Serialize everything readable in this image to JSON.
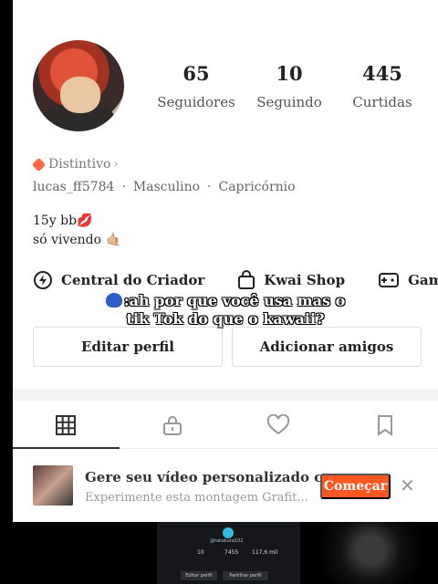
{
  "profile": {
    "stats": [
      {
        "value": "65",
        "label": "Seguidores"
      },
      {
        "value": "10",
        "label": "Seguindo"
      },
      {
        "value": "445",
        "label": "Curtidas"
      }
    ],
    "badge_label": "Distintivo",
    "username": "lucas_ff5784",
    "gender": "Masculino",
    "sign": "Capricórnio",
    "bio_line1": "15y bb💋",
    "bio_line2": "só vivendo 🤙🏼"
  },
  "links": {
    "creator": "Central do Criador",
    "shop": "Kwai Shop",
    "game": "Game"
  },
  "caption": {
    "line1": ":ah por que você usa mas o",
    "line2": "tik Tok do que o kawaii?"
  },
  "buttons": {
    "edit": "Editar perfil",
    "add_friends": "Adicionar amigos"
  },
  "tabs": [
    "grid-icon",
    "lock-icon",
    "heart-icon",
    "bookmark-icon"
  ],
  "promo": {
    "title": "Gere seu vídeo personalizado c...",
    "subtitle": "Experimente esta montagem Grafit...",
    "cta": "Começar"
  },
  "thumbnails": {
    "handle": "@takakura102",
    "stats": [
      "10",
      "7455",
      "117,6 mil"
    ],
    "buttons": [
      "Editar perfil",
      "Partilhar perfil"
    ]
  },
  "colors": {
    "accent": "#ff5722",
    "badge": "#ff6b4a",
    "caption_icon": "#2f5ec4"
  }
}
